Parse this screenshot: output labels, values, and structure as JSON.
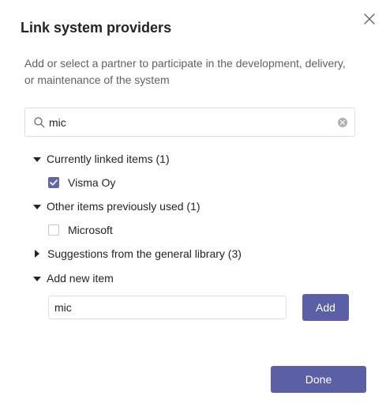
{
  "dialog": {
    "title": "Link system providers",
    "description": "Add or select a partner to participate in the development, delivery, or maintenance of the system",
    "close_icon": "close-icon"
  },
  "search": {
    "value": "mic",
    "search_icon": "search-icon",
    "clear_icon": "clear-icon"
  },
  "sections": {
    "currently_linked": {
      "label": "Currently linked items (1)",
      "expanded": true,
      "items": [
        {
          "label": "Visma Oy",
          "checked": true
        }
      ]
    },
    "previously_used": {
      "label": "Other items previously used (1)",
      "expanded": true,
      "items": [
        {
          "label": "Microsoft",
          "checked": false
        }
      ]
    },
    "suggestions": {
      "label": "Suggestions from the general library (3)",
      "expanded": false
    },
    "add_new": {
      "label": "Add new item",
      "expanded": true,
      "input_value": "mic",
      "add_label": "Add"
    }
  },
  "footer": {
    "done_label": "Done"
  },
  "colors": {
    "accent": "#5b5fa6",
    "text": "#242424",
    "muted_text": "#616161",
    "border": "#e1dfdd"
  }
}
